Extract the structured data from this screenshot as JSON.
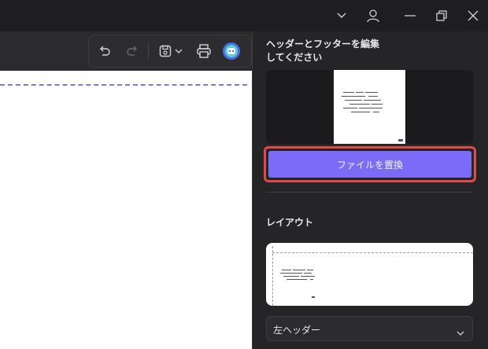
{
  "window": {
    "icons": [
      "chevron-down-icon",
      "account-icon",
      "minimize-icon",
      "restore-icon",
      "close-icon"
    ]
  },
  "toolbar": {
    "icons": [
      "undo-icon",
      "redo-icon",
      "save-icon",
      "save-menu-chevron-icon",
      "print-icon",
      "ai-assistant-icon"
    ]
  },
  "panel": {
    "title": "ヘッダーとフッターを編集してください",
    "replace_file_label": "ファイルを置換",
    "layout_label": "レイアウト",
    "position_select": {
      "selected": "左ヘッダー"
    }
  },
  "colors": {
    "accent": "#7a6cf6",
    "highlight": "#e04a4a",
    "guide_dash": "#7a78d8",
    "panel_bg": "#252528"
  }
}
